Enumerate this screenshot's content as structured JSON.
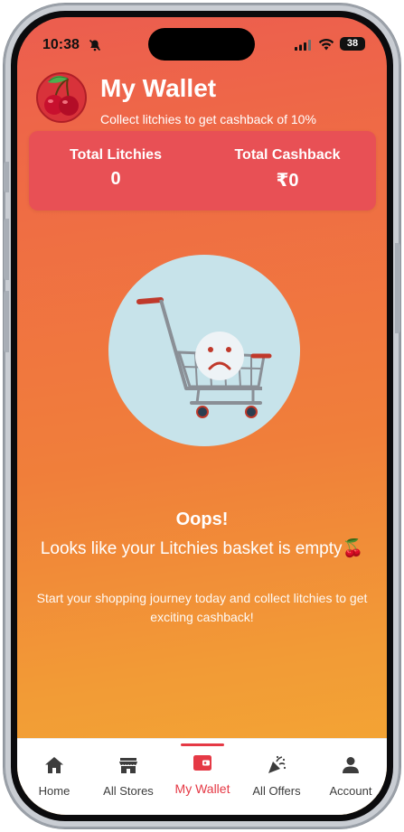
{
  "status_bar": {
    "time": "10:38",
    "battery": "38"
  },
  "header": {
    "title": "My Wallet",
    "subtitle": "Collect litchies to get cashback of 10%"
  },
  "stats": {
    "litchies_label": "Total Litchies",
    "litchies_value": "0",
    "cashback_label": "Total Cashback",
    "cashback_value": "₹0"
  },
  "empty_state": {
    "title": "Oops!",
    "message": "Looks like your Litchies basket is empty🍒",
    "subtext": "Start your shopping journey today and collect litchies to get exciting cashback!"
  },
  "bottom_nav": {
    "items": [
      {
        "label": "Home",
        "icon": "home-icon"
      },
      {
        "label": "All Stores",
        "icon": "store-icon"
      },
      {
        "label": "My Wallet",
        "icon": "wallet-icon",
        "active": true
      },
      {
        "label": "All Offers",
        "icon": "party-popper-icon"
      },
      {
        "label": "Account",
        "icon": "account-icon"
      }
    ]
  },
  "colors": {
    "accent": "#e53945",
    "card": "#e85055",
    "gradient_top": "#ec5d4f",
    "gradient_bottom": "#f4aa33"
  }
}
